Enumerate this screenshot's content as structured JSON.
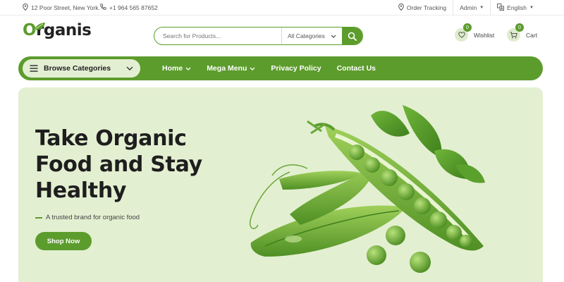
{
  "topbar": {
    "address": "12 Poor Street, New York.",
    "phone": "+1 964 565 87652",
    "order_tracking": "Order Tracking",
    "account": "Admin",
    "language": "English"
  },
  "header": {
    "logo_first": "O",
    "logo_rest": "rganis",
    "search_placeholder": "Search for Products...",
    "category_selected": "All Categories",
    "wishlist_label": "Wishlist",
    "wishlist_count": "0",
    "cart_label": "Cart",
    "cart_count": "0"
  },
  "nav": {
    "browse_label": "Browse Categories",
    "links": [
      {
        "label": "Home",
        "dropdown": true
      },
      {
        "label": "Mega Menu",
        "dropdown": true
      },
      {
        "label": "Privacy Policy",
        "dropdown": false
      },
      {
        "label": "Contact Us",
        "dropdown": false
      }
    ]
  },
  "hero": {
    "headline_lines": [
      "Take Organic",
      "Food and Stay",
      "Healthy"
    ],
    "tagline": "A trusted brand for organic food",
    "cta_label": "Shop Now"
  },
  "colors": {
    "brand_green": "#5c9c2c",
    "hero_background": "#e3efd1",
    "pill_light_green": "#e3efd3"
  },
  "icons": {
    "address": "map-pin-icon",
    "phone": "phone-icon",
    "tracking": "location-pin-icon",
    "language": "translate-icon",
    "search": "search-icon",
    "wishlist": "heart-icon",
    "cart": "cart-icon",
    "browse": "hamburger-menu-icon"
  }
}
